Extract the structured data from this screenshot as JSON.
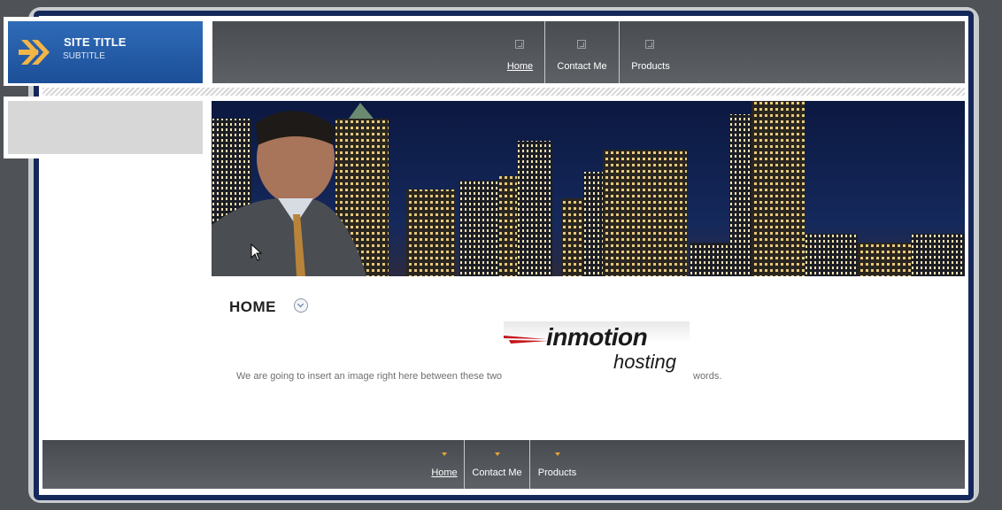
{
  "header": {
    "site_title": "SITE TITLE",
    "site_subtitle": "SUBTITLE"
  },
  "top_nav": {
    "items": [
      {
        "label": "Home",
        "active": true
      },
      {
        "label": "Contact Me",
        "active": false
      },
      {
        "label": "Products",
        "active": false
      }
    ]
  },
  "main": {
    "heading": "HOME",
    "text_before": "We are going to insert an image right here between these two",
    "text_after": "words.",
    "logo": {
      "word": "inmotion",
      "sub": "hosting"
    }
  },
  "bottom_nav": {
    "items": [
      {
        "label": "Home",
        "active": true
      },
      {
        "label": "Contact Me",
        "active": false
      },
      {
        "label": "Products",
        "active": false
      }
    ]
  },
  "colors": {
    "header_blue": "#2f6bb8",
    "arrow_orange": "#f1b548",
    "nav_dark": "#4f5358",
    "frame_navy": "#15285a"
  }
}
